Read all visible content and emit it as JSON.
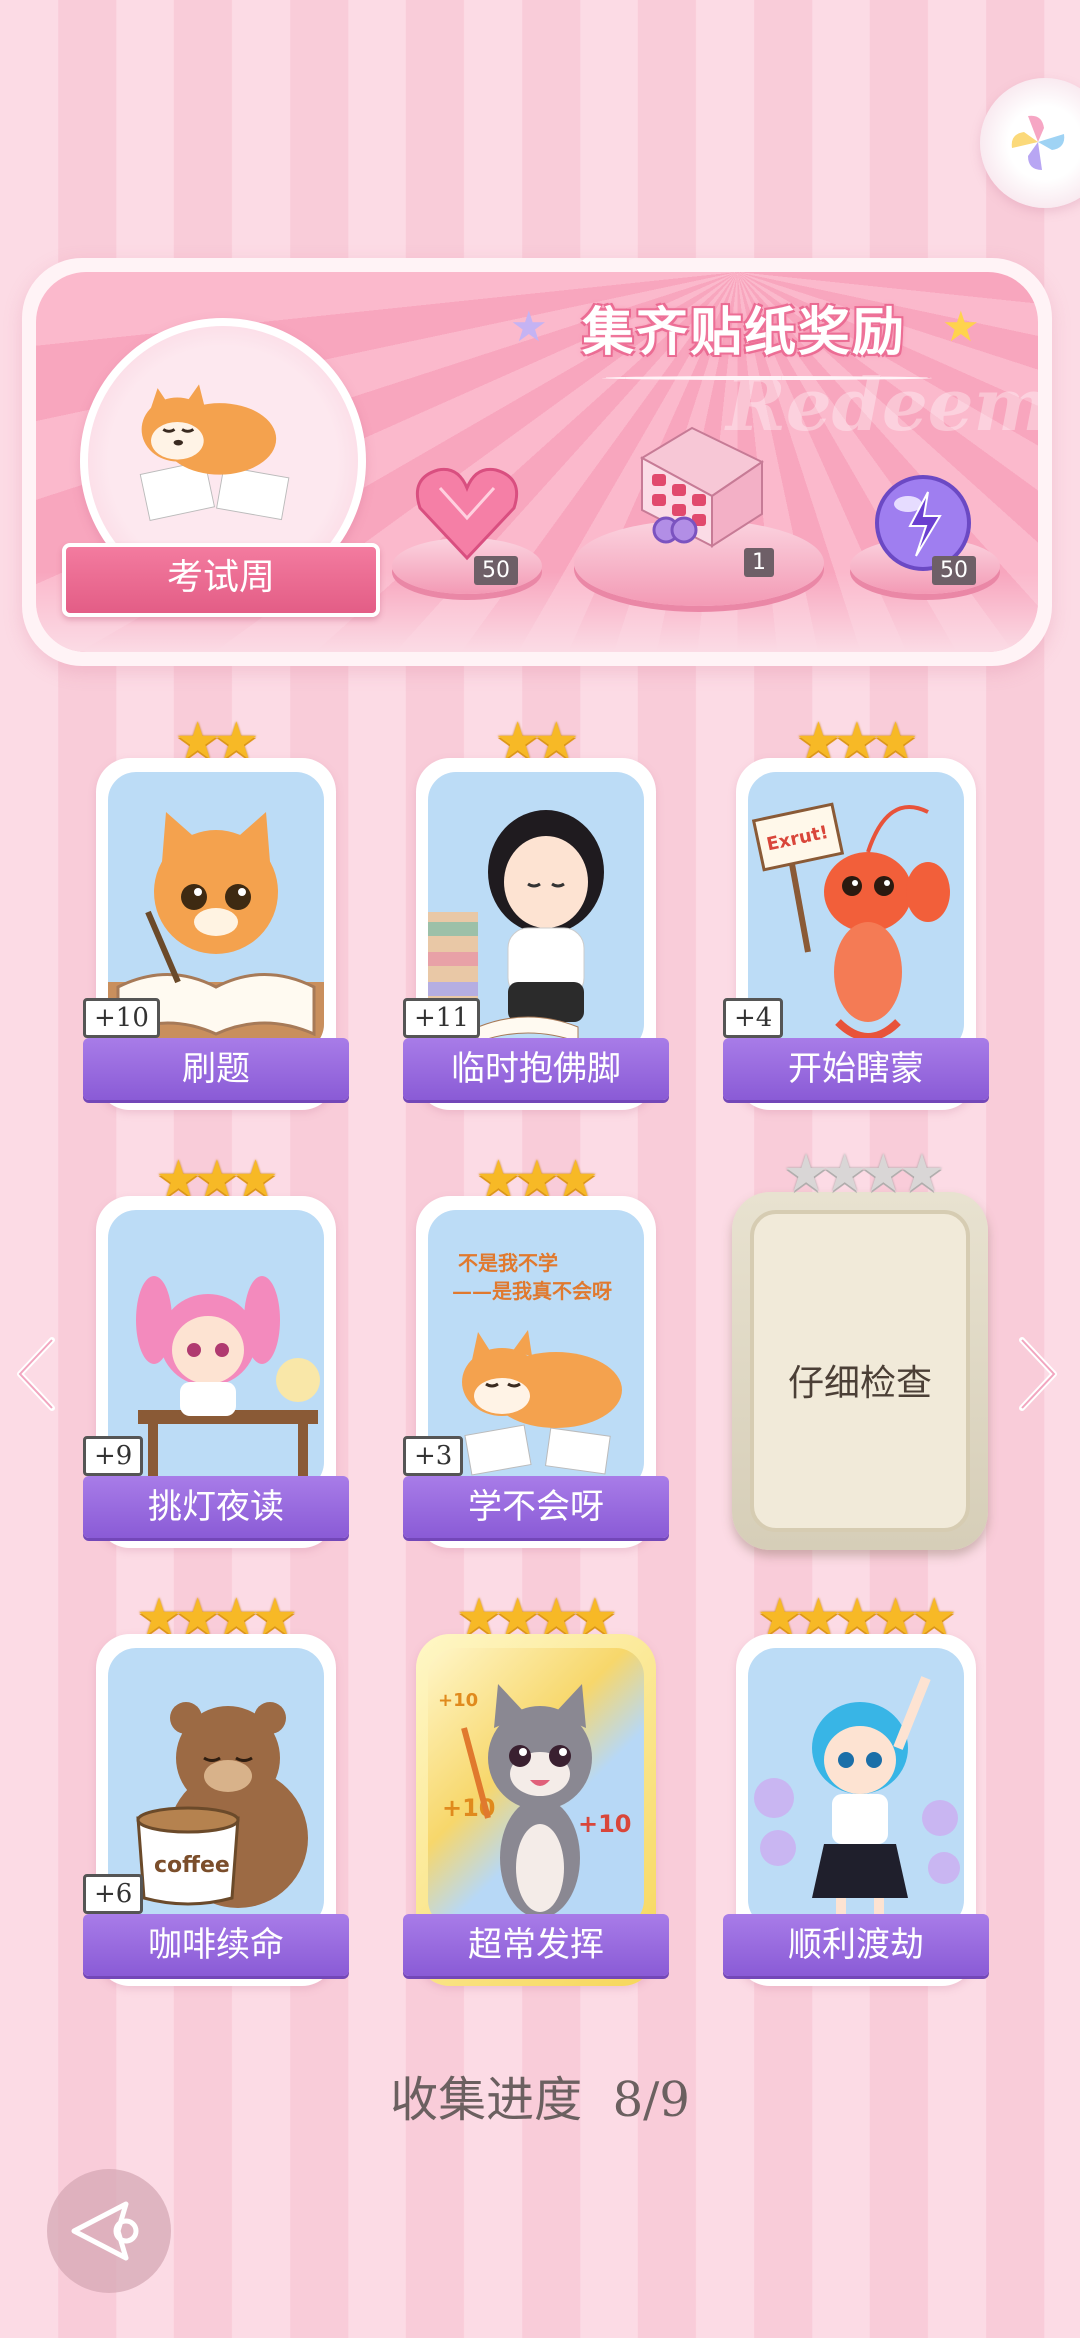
{
  "panel": {
    "title": "集齐贴纸奖励",
    "watermark": "Redeem",
    "badge_label": "考试周",
    "rewards": [
      {
        "icon": "heart-gem-icon",
        "count": "50"
      },
      {
        "icon": "gift-box-icon",
        "count": "1"
      },
      {
        "icon": "energy-orb-icon",
        "count": "50"
      }
    ]
  },
  "cards": [
    {
      "label": "刷题",
      "bonus": "+10",
      "stars": 2
    },
    {
      "label": "临时抱佛脚",
      "bonus": "+11",
      "stars": 2
    },
    {
      "label": "开始瞎蒙",
      "bonus": "+4",
      "stars": 3,
      "sign": "Exrut!"
    },
    {
      "label": "挑灯夜读",
      "bonus": "+9",
      "stars": 3
    },
    {
      "label": "学不会呀",
      "bonus": "+3",
      "stars": 3,
      "art_line1": "不是我不学",
      "art_line2": "——是我真不会呀"
    },
    {
      "label": "仔细检查",
      "stars": 4,
      "locked": true
    },
    {
      "label": "咖啡续命",
      "bonus": "+6",
      "stars": 4,
      "cup_text": "coffee"
    },
    {
      "label": "超常发挥",
      "stars": 4,
      "art_bonus_a": "+10",
      "art_bonus_b": "+10",
      "art_bonus_c": "+10"
    },
    {
      "label": "顺利渡劫",
      "stars": 5
    }
  ],
  "progress": {
    "label": "收集进度",
    "value": "8/9"
  },
  "colors": {
    "label_purple": "#9b6be0",
    "star_gold": "#f7b926",
    "panel_pink": "#f8a6be"
  }
}
